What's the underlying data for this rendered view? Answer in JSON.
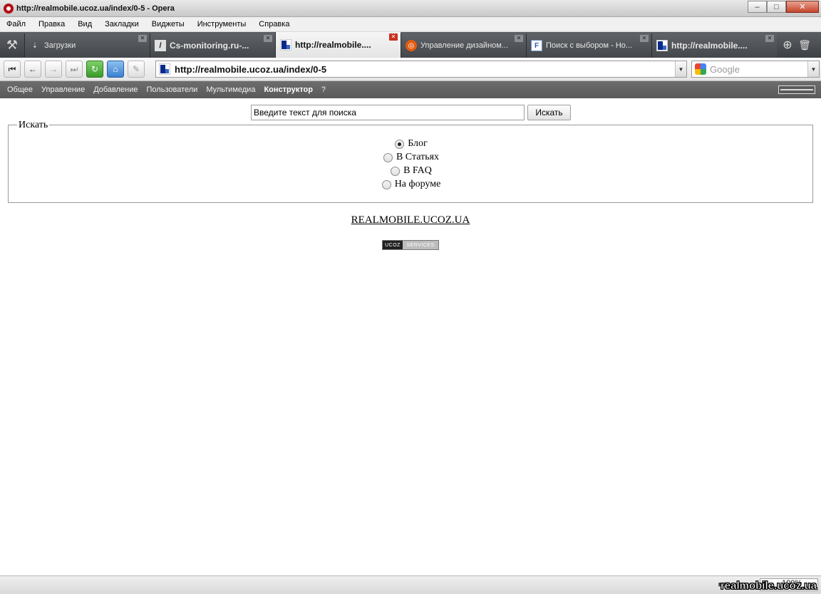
{
  "window": {
    "title": "http://realmobile.ucoz.ua/index/0-5 - Opera",
    "buttons": [
      "minimize",
      "maximize",
      "close"
    ]
  },
  "menu": [
    "Файл",
    "Правка",
    "Вид",
    "Закладки",
    "Виджеты",
    "Инструменты",
    "Справка"
  ],
  "tabs": [
    {
      "label": "Загрузки",
      "icon": "download-icon",
      "active": false
    },
    {
      "label": "Cs-monitoring.ru-...",
      "icon": "cs-favicon",
      "active": false
    },
    {
      "label": "http://realmobile....",
      "icon": "ucoz-favicon",
      "active": true
    },
    {
      "label": "Управление дизайном...",
      "icon": "ubuntu-favicon",
      "active": false
    },
    {
      "label": "Поиск с выбором - Но...",
      "icon": "f-favicon",
      "active": false
    },
    {
      "label": "http://realmobile....",
      "icon": "ucoz-favicon",
      "active": false
    }
  ],
  "address": {
    "url": "http://realmobile.ucoz.ua/index/0-5"
  },
  "search_engine": {
    "placeholder": "Google"
  },
  "ucoz_panel": {
    "items": [
      "Общее",
      "Управление",
      "Добавление",
      "Пользователи",
      "Мультимедиа",
      "Конструктор",
      "?"
    ],
    "bold_item": "Конструктор"
  },
  "page": {
    "search_input_value": "Введите текст для поиска",
    "search_button": "Искать",
    "legend": "Искать",
    "options": [
      {
        "label": "Блог",
        "checked": true
      },
      {
        "label": "В Статьях",
        "checked": false
      },
      {
        "label": "В FAQ",
        "checked": false
      },
      {
        "label": "На форуме",
        "checked": false
      }
    ],
    "site_link": "REALMOBILE.UCOZ.UA",
    "badge_left": "UCOZ",
    "badge_right": "SERVICES"
  },
  "statusbar": {
    "zoom": "100%",
    "watermark": "realmobile.ucoz.ua"
  },
  "colors": {
    "tab_bar": "#44474b",
    "ucoz_panel": "#5f5f5f",
    "close_button": "#c7452b"
  }
}
